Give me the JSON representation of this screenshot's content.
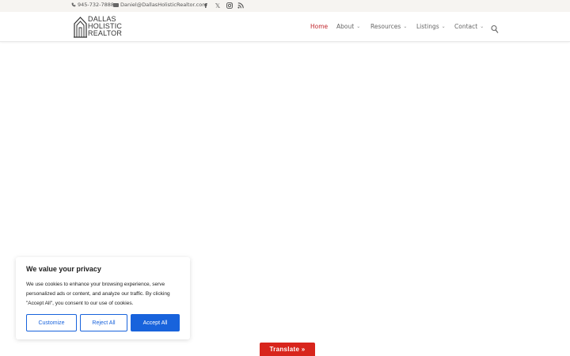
{
  "topbar": {
    "phone": "945-732-7888",
    "email": "Daniel@DallasHolisticRealtor.com",
    "social_icons": [
      "facebook-icon",
      "x-icon",
      "instagram-icon",
      "rss-icon"
    ],
    "facebook_glyph": "f",
    "x_glyph": "𝕏"
  },
  "header": {
    "logo": {
      "line1": "DALLAS",
      "line2": "HOLISTIC",
      "line3": "REALTOR"
    },
    "nav": [
      {
        "label": "Home",
        "active": true
      },
      {
        "label": "About",
        "dropdown": true
      },
      {
        "label": "Resources",
        "dropdown": true
      },
      {
        "label": "Listings",
        "dropdown": true
      },
      {
        "label": "Contact",
        "dropdown": true
      }
    ],
    "chevron": "⌄",
    "search_icon": "search-icon"
  },
  "cookie_banner": {
    "title": "We value your privacy",
    "body": "We use cookies to enhance your browsing experience, serve personalized ads or content, and analyze our traffic. By clicking \"Accept All\", you consent to our use of cookies.",
    "customize_label": "Customize",
    "reject_label": "Reject All",
    "accept_label": "Accept All"
  },
  "translate": {
    "label": "Translate »"
  },
  "colors": {
    "accent": "#c1272d",
    "cookie_blue": "#1863dc",
    "translate_red": "#d8251c"
  }
}
